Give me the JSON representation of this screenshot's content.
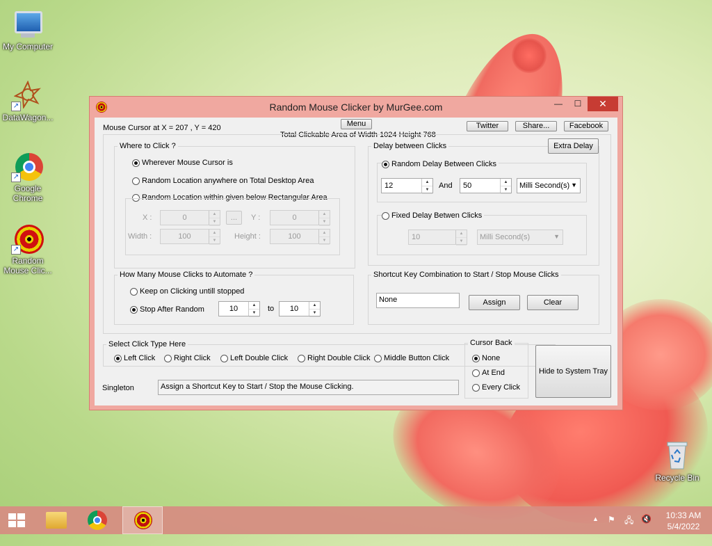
{
  "desktop": {
    "icons": [
      {
        "label": "My Computer"
      },
      {
        "label": "DataWagon..."
      },
      {
        "label": "Google Chrome"
      },
      {
        "label": "Random Mouse Clic..."
      },
      {
        "label": "Recycle Bin"
      }
    ]
  },
  "window": {
    "title": "Random Mouse Clicker by MurGee.com",
    "minimize": "—",
    "maximize": "☐",
    "close": "✕",
    "cursor_pos": "Mouse Cursor at X = 207 , Y = 420",
    "menu_label": "Menu",
    "clickable_area": "Total Clickable Area of Width 1024 Height 768",
    "twitter": "Twitter",
    "share": "Share...",
    "facebook": "Facebook",
    "where": {
      "title": "Where to Click ?",
      "opt1": "Wherever Mouse Cursor is",
      "opt2": "Random Location anywhere on Total Desktop Area",
      "opt3": "Random Location within given below Rectangular Area",
      "x_label": "X :",
      "x_value": "0",
      "dots": "...",
      "y_label": "Y :",
      "y_value": "0",
      "width_label": "Width :",
      "width_value": "100",
      "height_label": "Height :",
      "height_value": "100"
    },
    "delay": {
      "title": "Delay between Clicks",
      "extra_delay": "Extra Delay",
      "random_label": "Random Delay Between Clicks",
      "from_value": "12",
      "and_label": "And",
      "to_value": "50",
      "unit": "Milli Second(s)",
      "fixed_label": "Fixed Delay Betwen Clicks",
      "fixed_value": "10",
      "fixed_unit": "Milli Second(s)"
    },
    "count": {
      "title": "How Many Mouse Clicks to Automate ?",
      "opt1": "Keep on Clicking untill stopped",
      "opt2": "Stop After Random",
      "from_value": "10",
      "to_label": "to",
      "to_value": "10"
    },
    "shortcut": {
      "title": "Shortcut Key Combination to Start / Stop Mouse Clicks",
      "value": "None",
      "assign": "Assign",
      "clear": "Clear"
    },
    "click_type": {
      "title": "Select Click Type Here",
      "options": [
        "Left Click",
        "Right Click",
        "Left Double Click",
        "Right Double Click",
        "Middle Button Click"
      ],
      "selected": "Left Click"
    },
    "cursor_back": {
      "title": "Cursor Back",
      "options": [
        "None",
        "At End",
        "Every Click"
      ],
      "selected": "None"
    },
    "hide_tray": "Hide to System Tray",
    "singleton": "Singleton",
    "status": "Assign a Shortcut Key to Start / Stop the Mouse Clicking."
  },
  "taskbar": {
    "time": "10:33 AM",
    "date": "5/4/2022"
  }
}
